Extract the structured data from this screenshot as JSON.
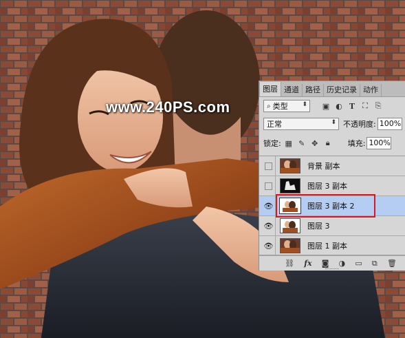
{
  "watermark": "www.240PS.com",
  "layers_panel": {
    "tabs": [
      {
        "label": "图层",
        "active": true
      },
      {
        "label": "通道",
        "active": false
      },
      {
        "label": "路径",
        "active": false
      },
      {
        "label": "历史记录",
        "active": false
      },
      {
        "label": "动作",
        "active": false
      }
    ],
    "filter": {
      "label": "类型",
      "search_icon": "search-icon"
    },
    "blend_mode": "正常",
    "opacity_label": "不透明度:",
    "opacity_value": "100%",
    "lock_label": "锁定:",
    "fill_label": "填充:",
    "fill_value": "100%",
    "layers": [
      {
        "name": "背景 副本",
        "visible": false,
        "selected": false,
        "thumb": "photo"
      },
      {
        "name": "图层 3 副本",
        "visible": false,
        "selected": false,
        "thumb": "dark"
      },
      {
        "name": "图层 3 副本 2",
        "visible": true,
        "selected": true,
        "thumb": "cutout"
      },
      {
        "name": "图层 3",
        "visible": true,
        "selected": false,
        "thumb": "cutout"
      },
      {
        "name": "图层 1 副本",
        "visible": true,
        "selected": false,
        "thumb": "photo"
      }
    ],
    "bottom_fx": "fx"
  },
  "colors": {
    "selection": "#b6cdf3",
    "highlight": "#e0141c",
    "panel_bg": "#d6d6d6"
  }
}
